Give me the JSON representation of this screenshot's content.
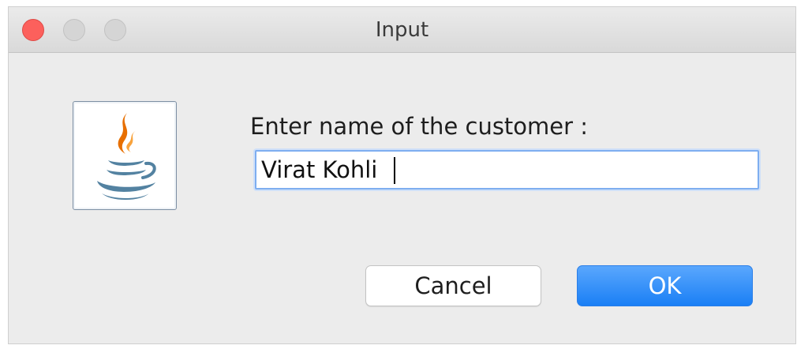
{
  "window": {
    "title": "Input"
  },
  "dialog": {
    "icon": "java-coffee-cup-icon",
    "prompt": "Enter name of the customer :",
    "input_value": "Virat Kohli"
  },
  "buttons": {
    "cancel_label": "Cancel",
    "ok_label": "OK"
  },
  "colors": {
    "close_button": "#fc605c",
    "ok_button": "#1a7ff5",
    "background": "#ececec"
  }
}
